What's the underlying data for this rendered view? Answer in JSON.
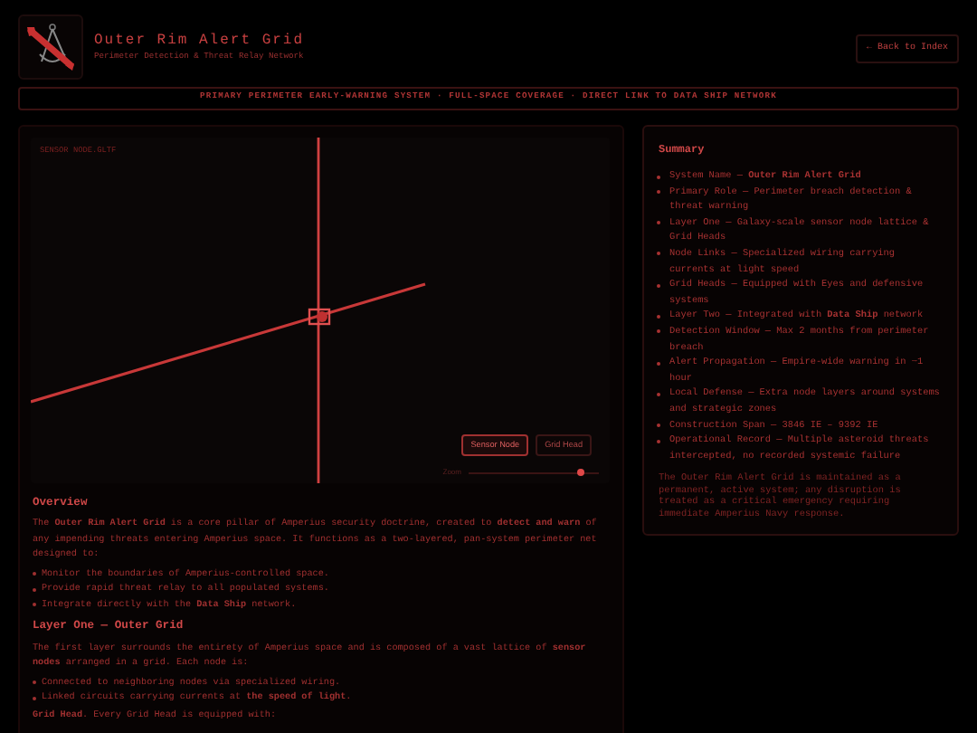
{
  "header": {
    "title": "Outer Rim Alert Grid",
    "subtitle": "Perimeter Detection & Threat Relay Network",
    "back_link": "← Back to Index"
  },
  "banner": "PRIMARY PERIMETER EARLY-WARNING SYSTEM · FULL-SPACE COVERAGE · DIRECT LINK TO DATA SHIP NETWORK",
  "viewer": {
    "label": "SENSOR NODE.GLTF",
    "buttons": [
      {
        "label": "Sensor Node",
        "selected": true
      },
      {
        "label": "Grid Head",
        "selected": false
      }
    ],
    "zoom_label": "Zoom",
    "zoom": {
      "level": 0.88
    }
  },
  "article": [
    {
      "kind": "heading",
      "text": "Overview"
    },
    {
      "kind": "para",
      "text": "The **Outer Rim Alert Grid** is a core pillar of Amperius security doctrine, created to **detect and warn** of any impending threats entering Amperius space. It functions as a two-layered, pan-system perimeter net designed to:"
    },
    {
      "kind": "list",
      "items": [
        "Monitor the boundaries of Amperius-controlled space.",
        "Provide rapid threat relay to all populated systems.",
        "Integrate directly with the **Data Ship** network."
      ]
    },
    {
      "kind": "heading",
      "text": "Layer One — Outer Grid"
    },
    {
      "kind": "para",
      "text": "The first layer surrounds the entirety of Amperius space and is composed of a vast lattice of **sensor nodes** arranged in a grid. Each node is:"
    },
    {
      "kind": "list",
      "items": [
        "Connected to neighboring nodes via specialized wiring.",
        "Linked circuits carrying currents at **the speed of light**."
      ]
    },
    {
      "kind": "para",
      "text": "**Grid Head**. Every Grid Head is equipped with:"
    }
  ],
  "summary": {
    "title": "Summary",
    "items": [
      "System Name — **Outer Rim Alert Grid**",
      "Primary Role — Perimeter breach detection & threat warning",
      "Layer One — Galaxy-scale sensor node lattice & Grid Heads",
      "Node Links — Specialized wiring carrying currents at light speed",
      "Grid Heads — Equipped with Eyes and defensive systems",
      "Layer Two — Integrated with **Data Ship** network",
      "Detection Window — Max 2 months from perimeter breach",
      "Alert Propagation — Empire-wide warning in ~1 hour",
      "Local Defense — Extra node layers around systems and strategic zones",
      "Construction Span — 3846 IE – 9392 IE",
      "Operational Record — Multiple asteroid threats intercepted, no recorded systemic failure"
    ],
    "note": "The Outer Rim Alert Grid is maintained as a permanent, active system; any disruption is treated as a critical emergency requiring immediate Amperius Navy response."
  }
}
